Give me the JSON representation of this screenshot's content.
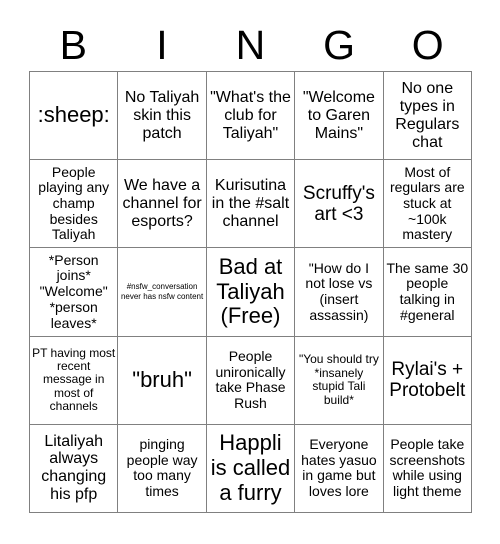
{
  "header": {
    "letters": [
      "B",
      "I",
      "N",
      "G",
      "O"
    ]
  },
  "colors": {
    "background": "#ffffff",
    "text": "#000000",
    "border": "#808080"
  },
  "grid": {
    "rows": 5,
    "columns": 5,
    "cells": [
      [
        {
          "text": ":sheep:",
          "size": "xl"
        },
        {
          "text": "No Taliyah skin this patch",
          "size": "md"
        },
        {
          "text": "\"What's the club for Taliyah\"",
          "size": "md"
        },
        {
          "text": "\"Welcome to Garen Mains\"",
          "size": "md"
        },
        {
          "text": "No one types in Regulars chat",
          "size": "md"
        }
      ],
      [
        {
          "text": "People playing any champ besides Taliyah",
          "size": "sm"
        },
        {
          "text": "We have a channel for esports?",
          "size": "md"
        },
        {
          "text": "Kurisutina in the #salt channel",
          "size": "md"
        },
        {
          "text": "Scruffy's art <3",
          "size": "lg"
        },
        {
          "text": "Most of regulars are stuck at ~100k mastery",
          "size": "sm"
        }
      ],
      [
        {
          "text": "*Person joins* \"Welcome\" *person leaves*",
          "size": "sm"
        },
        {
          "text": "#nsfw_conversation never has nsfw content",
          "size": "tiny"
        },
        {
          "text": "Bad at Taliyah (Free)",
          "size": "xl"
        },
        {
          "text": "\"How do I not lose vs (insert assassin)",
          "size": "sm"
        },
        {
          "text": "The same 30 people talking in #general",
          "size": "sm"
        }
      ],
      [
        {
          "text": "PT having most recent message in most of channels",
          "size": "xs"
        },
        {
          "text": "\"bruh\"",
          "size": "xl"
        },
        {
          "text": "People unironically take Phase Rush",
          "size": "sm"
        },
        {
          "text": "\"You should try *insanely stupid Tali build*",
          "size": "xs"
        },
        {
          "text": "Rylai's + Protobelt",
          "size": "lg"
        }
      ],
      [
        {
          "text": "Litaliyah always changing his pfp",
          "size": "md"
        },
        {
          "text": "pinging people way too many times",
          "size": "sm"
        },
        {
          "text": "Happli is called a furry",
          "size": "xl"
        },
        {
          "text": "Everyone hates yasuo in game but loves lore",
          "size": "sm"
        },
        {
          "text": "People take screenshots while using light theme",
          "size": "sm"
        }
      ]
    ]
  }
}
